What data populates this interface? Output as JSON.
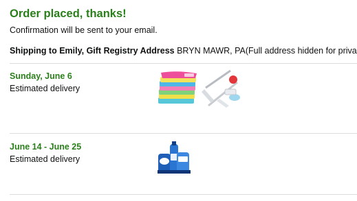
{
  "header": {
    "title": "Order placed, thanks!",
    "confirmation": "Confirmation will be sent to your email."
  },
  "shipping": {
    "label": "Shipping to Emily, Gift Registry Address",
    "address": " BRYN MAWR, PA(Full address hidden for privacy)"
  },
  "deliveries": [
    {
      "date": "Sunday, June 6",
      "note": "Estimated delivery",
      "items": [
        "microfiber-cloths-image",
        "spin-mop-image"
      ]
    },
    {
      "date": "June 14 - June 25",
      "note": "Estimated delivery",
      "items": [
        "dish-soap-bundle-image"
      ]
    }
  ],
  "colors": {
    "accent_green": "#2a7f1b",
    "divider": "#dddddd",
    "text": "#0f1111"
  }
}
